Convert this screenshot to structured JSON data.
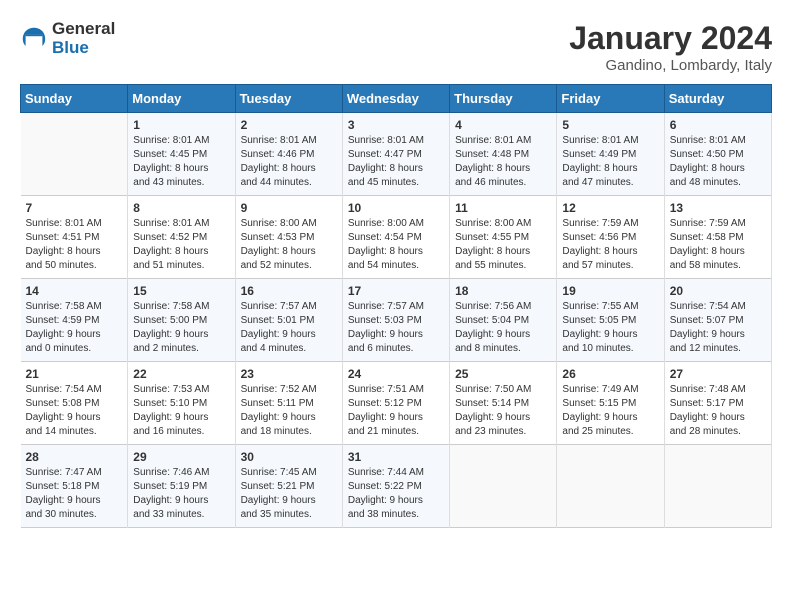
{
  "header": {
    "logo_general": "General",
    "logo_blue": "Blue",
    "month_year": "January 2024",
    "location": "Gandino, Lombardy, Italy"
  },
  "weekdays": [
    "Sunday",
    "Monday",
    "Tuesday",
    "Wednesday",
    "Thursday",
    "Friday",
    "Saturday"
  ],
  "weeks": [
    [
      {
        "day": "",
        "info": ""
      },
      {
        "day": "1",
        "info": "Sunrise: 8:01 AM\nSunset: 4:45 PM\nDaylight: 8 hours\nand 43 minutes."
      },
      {
        "day": "2",
        "info": "Sunrise: 8:01 AM\nSunset: 4:46 PM\nDaylight: 8 hours\nand 44 minutes."
      },
      {
        "day": "3",
        "info": "Sunrise: 8:01 AM\nSunset: 4:47 PM\nDaylight: 8 hours\nand 45 minutes."
      },
      {
        "day": "4",
        "info": "Sunrise: 8:01 AM\nSunset: 4:48 PM\nDaylight: 8 hours\nand 46 minutes."
      },
      {
        "day": "5",
        "info": "Sunrise: 8:01 AM\nSunset: 4:49 PM\nDaylight: 8 hours\nand 47 minutes."
      },
      {
        "day": "6",
        "info": "Sunrise: 8:01 AM\nSunset: 4:50 PM\nDaylight: 8 hours\nand 48 minutes."
      }
    ],
    [
      {
        "day": "7",
        "info": "Sunrise: 8:01 AM\nSunset: 4:51 PM\nDaylight: 8 hours\nand 50 minutes."
      },
      {
        "day": "8",
        "info": "Sunrise: 8:01 AM\nSunset: 4:52 PM\nDaylight: 8 hours\nand 51 minutes."
      },
      {
        "day": "9",
        "info": "Sunrise: 8:00 AM\nSunset: 4:53 PM\nDaylight: 8 hours\nand 52 minutes."
      },
      {
        "day": "10",
        "info": "Sunrise: 8:00 AM\nSunset: 4:54 PM\nDaylight: 8 hours\nand 54 minutes."
      },
      {
        "day": "11",
        "info": "Sunrise: 8:00 AM\nSunset: 4:55 PM\nDaylight: 8 hours\nand 55 minutes."
      },
      {
        "day": "12",
        "info": "Sunrise: 7:59 AM\nSunset: 4:56 PM\nDaylight: 8 hours\nand 57 minutes."
      },
      {
        "day": "13",
        "info": "Sunrise: 7:59 AM\nSunset: 4:58 PM\nDaylight: 8 hours\nand 58 minutes."
      }
    ],
    [
      {
        "day": "14",
        "info": "Sunrise: 7:58 AM\nSunset: 4:59 PM\nDaylight: 9 hours\nand 0 minutes."
      },
      {
        "day": "15",
        "info": "Sunrise: 7:58 AM\nSunset: 5:00 PM\nDaylight: 9 hours\nand 2 minutes."
      },
      {
        "day": "16",
        "info": "Sunrise: 7:57 AM\nSunset: 5:01 PM\nDaylight: 9 hours\nand 4 minutes."
      },
      {
        "day": "17",
        "info": "Sunrise: 7:57 AM\nSunset: 5:03 PM\nDaylight: 9 hours\nand 6 minutes."
      },
      {
        "day": "18",
        "info": "Sunrise: 7:56 AM\nSunset: 5:04 PM\nDaylight: 9 hours\nand 8 minutes."
      },
      {
        "day": "19",
        "info": "Sunrise: 7:55 AM\nSunset: 5:05 PM\nDaylight: 9 hours\nand 10 minutes."
      },
      {
        "day": "20",
        "info": "Sunrise: 7:54 AM\nSunset: 5:07 PM\nDaylight: 9 hours\nand 12 minutes."
      }
    ],
    [
      {
        "day": "21",
        "info": "Sunrise: 7:54 AM\nSunset: 5:08 PM\nDaylight: 9 hours\nand 14 minutes."
      },
      {
        "day": "22",
        "info": "Sunrise: 7:53 AM\nSunset: 5:10 PM\nDaylight: 9 hours\nand 16 minutes."
      },
      {
        "day": "23",
        "info": "Sunrise: 7:52 AM\nSunset: 5:11 PM\nDaylight: 9 hours\nand 18 minutes."
      },
      {
        "day": "24",
        "info": "Sunrise: 7:51 AM\nSunset: 5:12 PM\nDaylight: 9 hours\nand 21 minutes."
      },
      {
        "day": "25",
        "info": "Sunrise: 7:50 AM\nSunset: 5:14 PM\nDaylight: 9 hours\nand 23 minutes."
      },
      {
        "day": "26",
        "info": "Sunrise: 7:49 AM\nSunset: 5:15 PM\nDaylight: 9 hours\nand 25 minutes."
      },
      {
        "day": "27",
        "info": "Sunrise: 7:48 AM\nSunset: 5:17 PM\nDaylight: 9 hours\nand 28 minutes."
      }
    ],
    [
      {
        "day": "28",
        "info": "Sunrise: 7:47 AM\nSunset: 5:18 PM\nDaylight: 9 hours\nand 30 minutes."
      },
      {
        "day": "29",
        "info": "Sunrise: 7:46 AM\nSunset: 5:19 PM\nDaylight: 9 hours\nand 33 minutes."
      },
      {
        "day": "30",
        "info": "Sunrise: 7:45 AM\nSunset: 5:21 PM\nDaylight: 9 hours\nand 35 minutes."
      },
      {
        "day": "31",
        "info": "Sunrise: 7:44 AM\nSunset: 5:22 PM\nDaylight: 9 hours\nand 38 minutes."
      },
      {
        "day": "",
        "info": ""
      },
      {
        "day": "",
        "info": ""
      },
      {
        "day": "",
        "info": ""
      }
    ]
  ]
}
